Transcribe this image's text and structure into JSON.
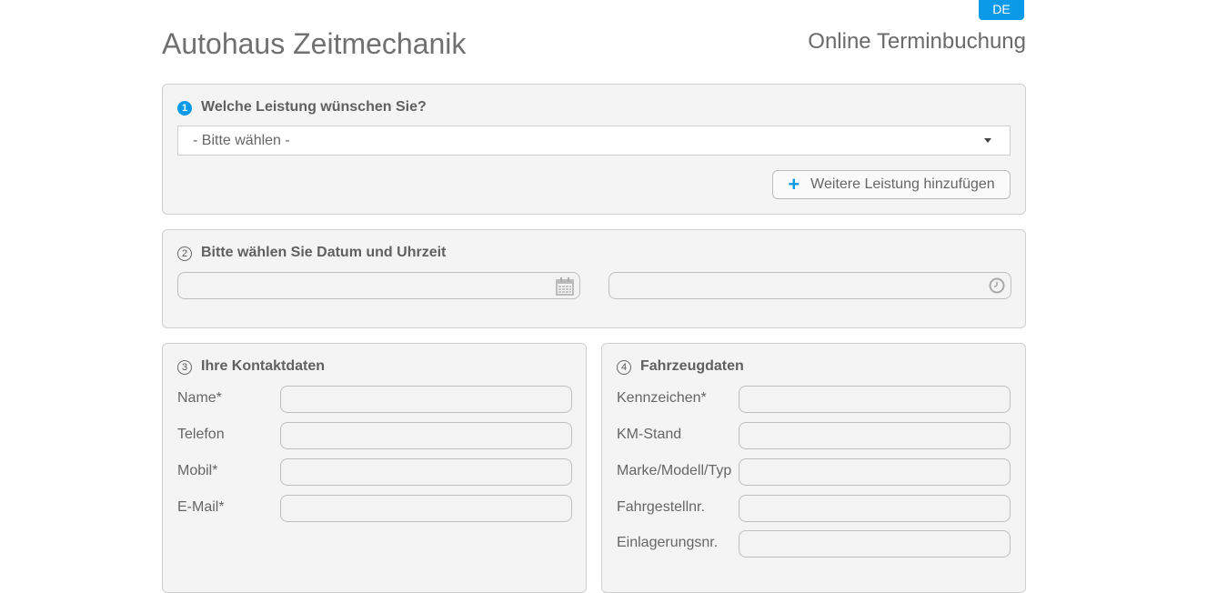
{
  "header": {
    "language": "DE",
    "brand": "Autohaus Zeitmechanik",
    "subtitle": "Online Terminbuchung"
  },
  "step1": {
    "number": "1",
    "title": "Welche Leistung wünschen Sie?",
    "select_value": "- Bitte wählen -",
    "add_button_label": "Weitere Leistung hinzufügen"
  },
  "step2": {
    "number": "2",
    "title": "Bitte wählen Sie Datum und Uhrzeit",
    "date_value": "",
    "time_value": ""
  },
  "step3": {
    "number": "3",
    "title": "Ihre Kontaktdaten",
    "fields": [
      {
        "label": "Name*",
        "value": ""
      },
      {
        "label": "Telefon",
        "value": ""
      },
      {
        "label": "Mobil*",
        "value": ""
      },
      {
        "label": "E-Mail*",
        "value": ""
      }
    ]
  },
  "step4": {
    "number": "4",
    "title": "Fahrzeugdaten",
    "fields": [
      {
        "label": "Kennzeichen*",
        "value": ""
      },
      {
        "label": "KM-Stand",
        "value": ""
      },
      {
        "label": "Marke/Modell/Typ",
        "value": ""
      },
      {
        "label": "Fahrgestellnr.",
        "value": ""
      },
      {
        "label": "Einlagerungsnr.",
        "value": ""
      }
    ]
  },
  "colors": {
    "accent": "#0a9ae8",
    "panel_bg": "#f4f4f4",
    "border": "#cfcfcf"
  },
  "icons": {
    "date": "calendar-icon",
    "time": "clock-icon",
    "add": "plus-icon",
    "dropdown": "caret-down-icon"
  }
}
